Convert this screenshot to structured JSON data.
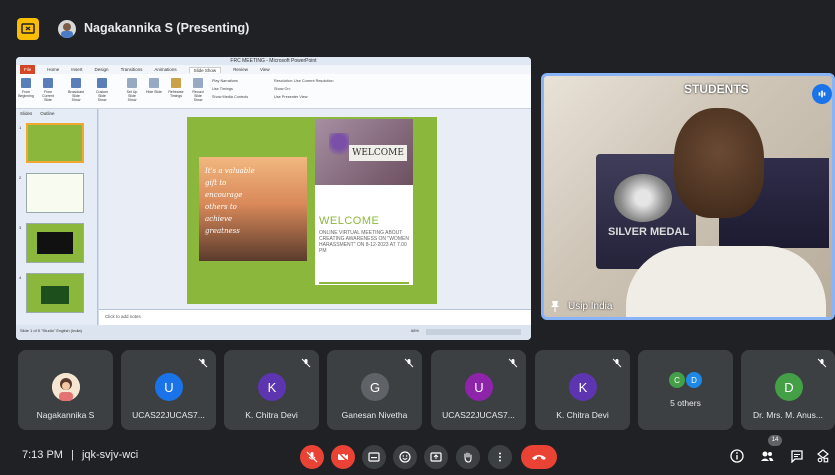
{
  "header": {
    "presenter_name": "Nagakannika S (Presenting)"
  },
  "powerpoint": {
    "window_title": "FRC MEETING - Microsoft PowerPoint",
    "tabs": [
      "File",
      "Home",
      "Insert",
      "Design",
      "Transitions",
      "Animations",
      "Slide Show",
      "Review",
      "View"
    ],
    "active_tab": "Slide Show",
    "ribbon_buttons": [
      "From Beginning",
      "From Current Slide",
      "Broadcast Slide Show",
      "Custom Slide Show",
      "Set Up Slide Show",
      "Hide Slide",
      "Rehearse Timings",
      "Record Slide Show"
    ],
    "ribbon_options": [
      "Play Narrations",
      "Use Timings",
      "Show Media Controls",
      "Resolution: Use Current Resolution",
      "Show On:",
      "Use Presenter View"
    ],
    "pane_tabs": [
      "Slides",
      "Outline"
    ],
    "thumb_numbers": [
      "1",
      "2",
      "3",
      "4"
    ],
    "notes_placeholder": "Click to add notes",
    "status_text": "Slide 1 of 5  \"Studio\"  English (India)",
    "zoom": "68%",
    "slide": {
      "left_text": "It's a valuable gift to encourage others to achieve greatness",
      "sign_text": "WELCOME",
      "welcome_heading": "WELCOME",
      "welcome_body": "ONLINE VIRTUAL MEETING ABOUT CREATING AWARENESS ON \"WOMEN HARASSMENT\" ON 8-12-2023 AT 7.00 PM"
    }
  },
  "video": {
    "participant_name": "Usip India",
    "background_text": "STUDENTS",
    "medal_text": "SILVER MEDAL"
  },
  "participants": [
    {
      "name": "Nagakannika S",
      "initial": "",
      "color": "",
      "muted": false
    },
    {
      "name": "UCAS22JUCAS7...",
      "initial": "U",
      "color": "#1a73e8",
      "muted": true
    },
    {
      "name": "K. Chitra Devi",
      "initial": "K",
      "color": "#5e35b1",
      "muted": true
    },
    {
      "name": "Ganesan Nivetha",
      "initial": "G",
      "color": "#5f6368",
      "muted": true
    },
    {
      "name": "UCAS22JUCAS7...",
      "initial": "U",
      "color": "#8e24aa",
      "muted": true
    },
    {
      "name": "K. Chitra Devi",
      "initial": "K",
      "color": "#5e35b1",
      "muted": true
    },
    {
      "name": "5 others",
      "initial": "",
      "color": "",
      "muted": false
    },
    {
      "name": "Dr. Mrs. M. Anus...",
      "initial": "D",
      "color": "#43a047",
      "muted": true
    }
  ],
  "others_avatars": [
    {
      "initial": "C",
      "color": "#43a047"
    },
    {
      "initial": "D",
      "color": "#1e88e5"
    }
  ],
  "bottom_bar": {
    "time": "7:13 PM",
    "separator": "|",
    "meeting_code": "jqk-svjv-wci",
    "participant_count": "14"
  }
}
